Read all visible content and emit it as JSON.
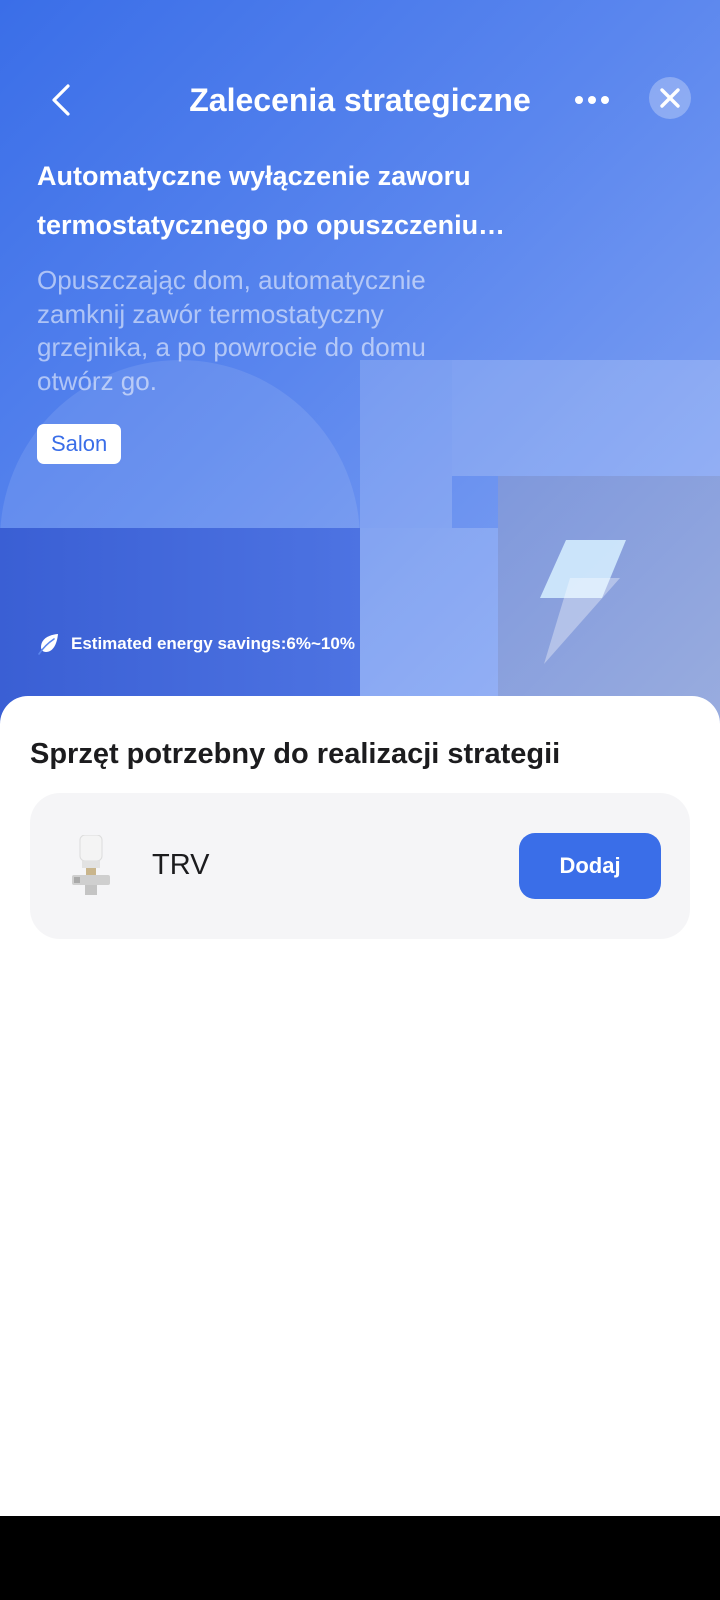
{
  "header": {
    "title": "Zalecenia strategiczne",
    "back_icon": "chevron-left-icon",
    "more_icon": "more-horizontal-icon",
    "close_icon": "close-icon"
  },
  "strategy": {
    "title_line1": "Automatyczne wyłączenie zaworu",
    "title_line2": "termostatycznego po opuszczeniu…",
    "description": "Opuszczając dom, automatycznie zamknij zawór termostatyczny grzejnika, a po powrocie do domu otwórz go.",
    "room": "Salon",
    "savings": "Estimated energy savings:6%~10%",
    "savings_icon": "leaf-icon",
    "illustration_icon": "lightning-bolt-icon"
  },
  "equipment": {
    "section_title": "Sprzęt potrzebny do realizacji strategii",
    "devices": [
      {
        "name": "TRV",
        "icon": "thermostatic-valve-icon",
        "action_label": "Dodaj"
      }
    ]
  },
  "colors": {
    "accent": "#3a6ee8",
    "hero_gradient_start": "#3a6ee8",
    "hero_gradient_end": "#8aa9f4",
    "card_background": "#f5f5f7",
    "nav_bar": "#000000"
  }
}
